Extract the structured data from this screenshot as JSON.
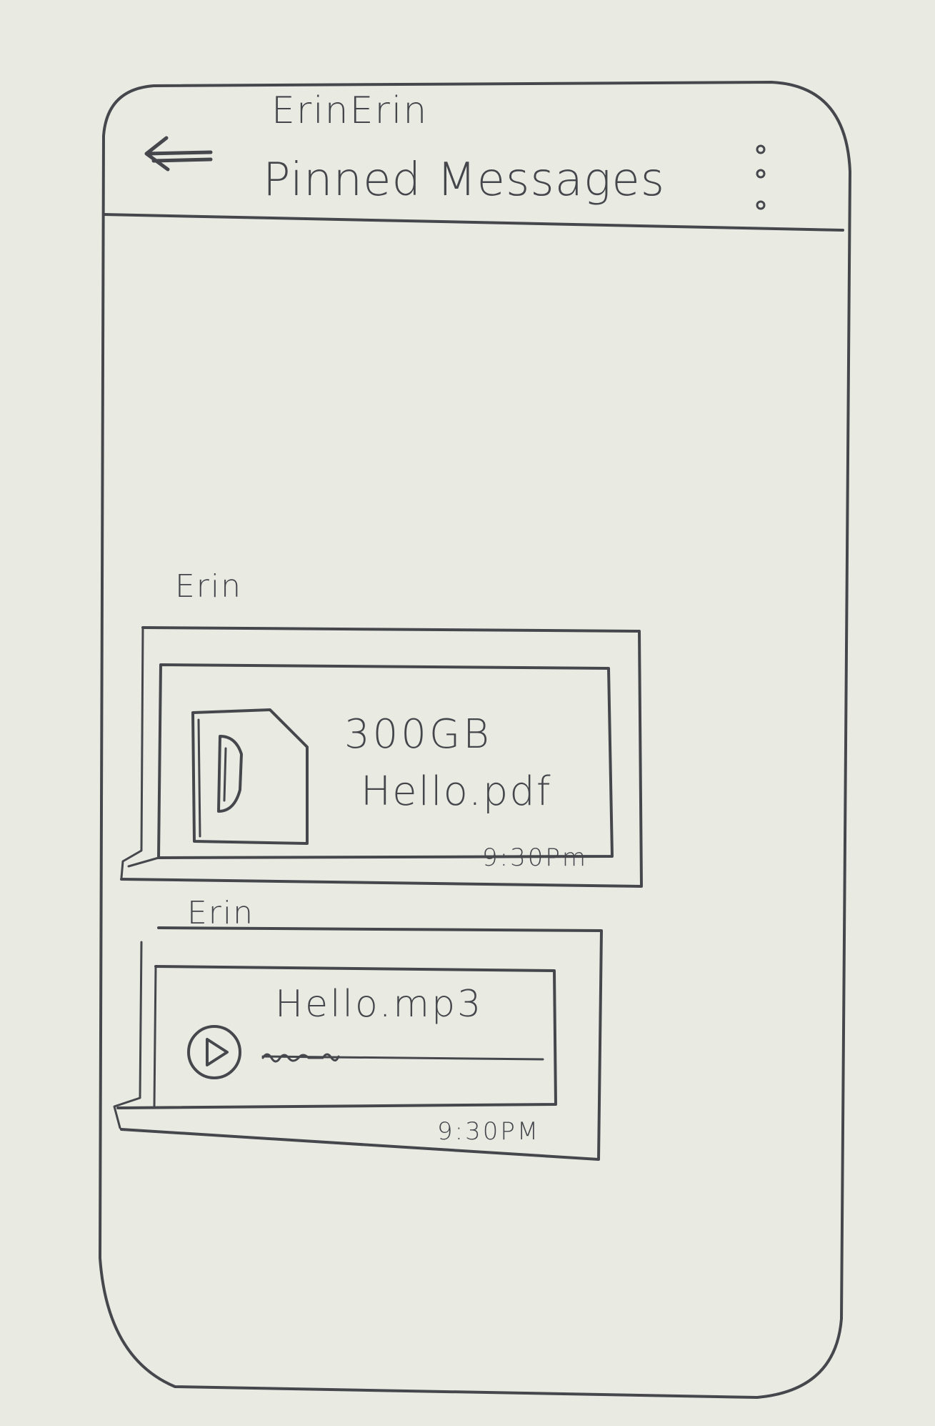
{
  "header": {
    "contact_name": "ErinErin",
    "title": "Pinned Messages",
    "back_icon": "arrow-left-icon",
    "menu_icon": "more-vertical-icon"
  },
  "messages": [
    {
      "sender": "Erin",
      "type": "file",
      "icon": "document-icon",
      "size": "300GB",
      "filename": "Hello.pdf",
      "time": "9:30Pm"
    },
    {
      "sender": "Erin",
      "type": "audio",
      "icon": "play-icon",
      "filename": "Hello.mp3",
      "time": "9:30PM"
    }
  ]
}
